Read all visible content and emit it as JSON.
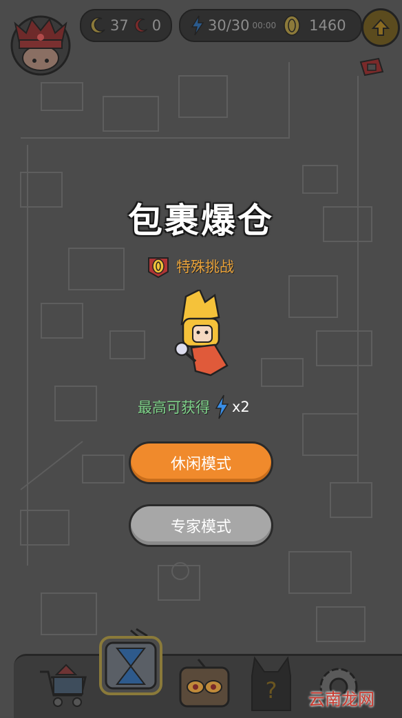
{
  "hud": {
    "moon_count": "37",
    "red_moon_count": "0",
    "energy": "30/30",
    "energy_timer": "00:00",
    "coins": "1460"
  },
  "stage": {
    "title": "包裹爆仓",
    "tag": "特殊挑战",
    "reward_label": "最高可获得",
    "reward_multiplier": "x2"
  },
  "buttons": {
    "casual": "休闲模式",
    "expert": "专家模式"
  },
  "watermark": "云南龙网"
}
